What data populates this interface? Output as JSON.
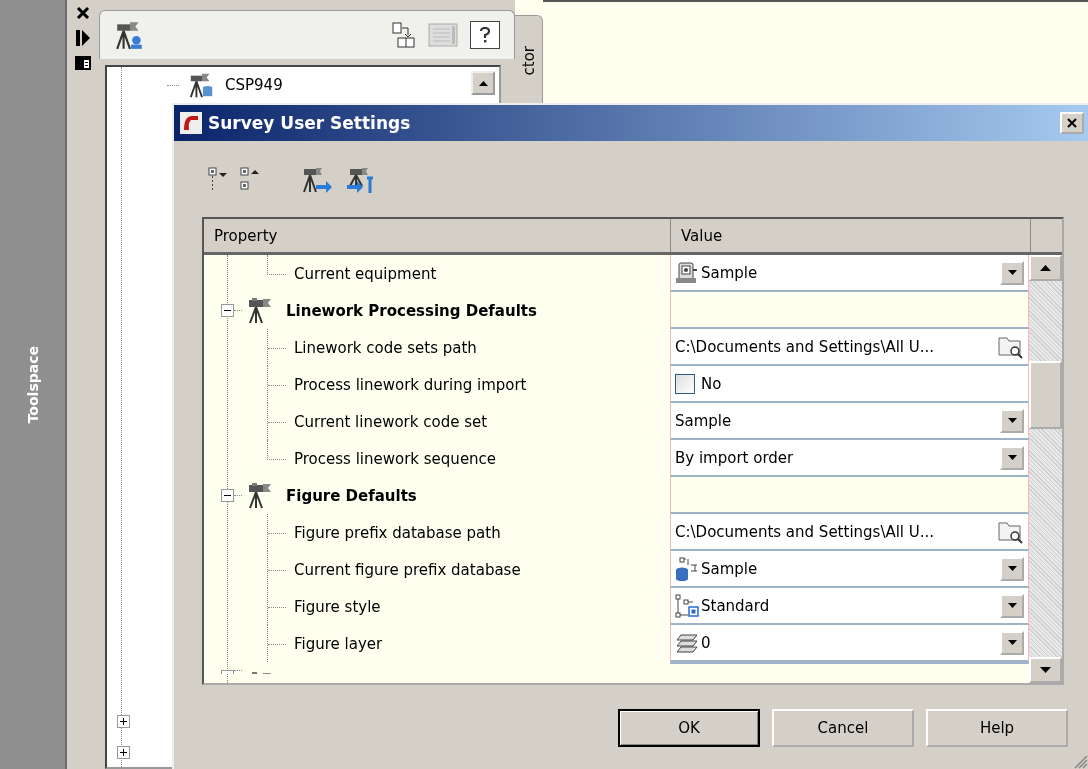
{
  "toolspace": {
    "label": "Toolspace",
    "tab_label": "ctor",
    "tree_item": "CSP949"
  },
  "dialog": {
    "title": "Survey User Settings",
    "columns": [
      "Property",
      "Value"
    ],
    "rows": [
      {
        "kind": "dropdown",
        "property": "Current equipment",
        "value": "Sample"
      },
      {
        "kind": "group",
        "label": "Linework Processing Defaults",
        "expanded": true
      },
      {
        "kind": "browse",
        "property": "Linework code sets path",
        "value": "C:\\Documents and Settings\\All U..."
      },
      {
        "kind": "checkbox",
        "property": "Process linework during import",
        "value": "No",
        "checked": false
      },
      {
        "kind": "dropdown",
        "property": "Current linework code set",
        "value": "Sample"
      },
      {
        "kind": "dropdown",
        "property": "Process linework sequence",
        "value": "By import order"
      },
      {
        "kind": "group",
        "label": "Figure Defaults",
        "expanded": true
      },
      {
        "kind": "browse",
        "property": "Figure prefix database path",
        "value": "C:\\Documents and Settings\\All U..."
      },
      {
        "kind": "dropdown",
        "property": "Current figure prefix database",
        "value": "Sample"
      },
      {
        "kind": "dropdown",
        "property": "Figure style",
        "value": "Standard"
      },
      {
        "kind": "dropdown",
        "property": "Figure layer",
        "value": "0"
      }
    ],
    "buttons": [
      {
        "label": "OK",
        "default": true
      },
      {
        "label": "Cancel",
        "default": false
      },
      {
        "label": "Help",
        "default": false
      }
    ]
  }
}
